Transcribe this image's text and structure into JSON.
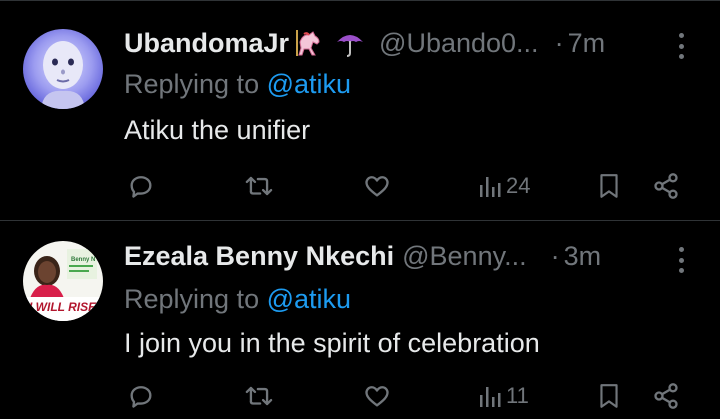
{
  "tweets": [
    {
      "display_name": "UbandomaJr",
      "emojis": [
        "carousel-horse-icon",
        "umbrella-icon"
      ],
      "handle": "@Ubando0...",
      "dot": "·",
      "time": "7m",
      "replying_prefix": "Replying to",
      "replying_to": "@atiku",
      "text": "Atiku the unifier",
      "views": "24"
    },
    {
      "display_name": "Ezeala Benny Nkechi",
      "handle": "@Benny...",
      "dot": "·",
      "time": "3m",
      "replying_prefix": "Replying to",
      "replying_to": "@atiku",
      "text": "I join you in the spirit of celebration",
      "views": "11",
      "avatar_text": "I WILL RISE UP"
    }
  ],
  "colors": {
    "background": "#000000",
    "primary_text": "#e7e9ea",
    "secondary_text": "#71767b",
    "link": "#1d9bf0",
    "divider": "#2f3336"
  }
}
